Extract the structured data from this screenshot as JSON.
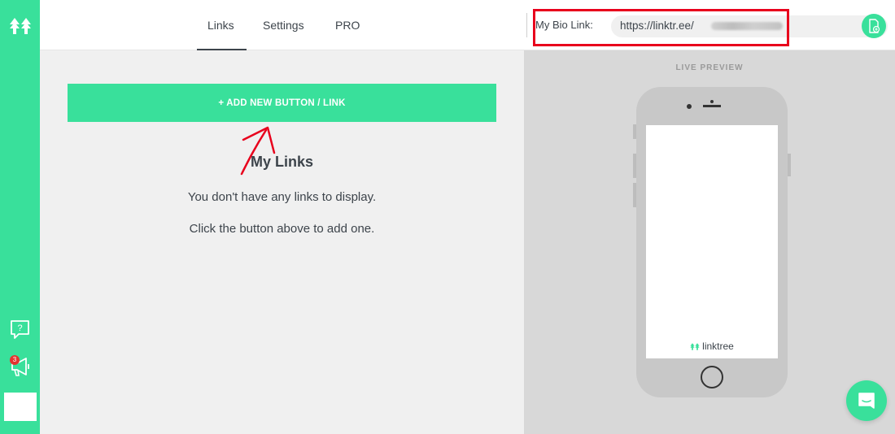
{
  "nav": {
    "tabs": [
      {
        "label": "Links"
      },
      {
        "label": "Settings"
      },
      {
        "label": "PRO"
      }
    ]
  },
  "sidebar": {
    "notification_count": "3",
    "icons": [
      "linktree-logo-icon",
      "help-icon",
      "megaphone-icon",
      "avatar"
    ]
  },
  "main": {
    "add_button_label": "+ ADD NEW BUTTON / LINK",
    "my_links_title": "My Links",
    "empty_message_1": "You don't have any links to display.",
    "empty_message_2": "Click the button above to add one."
  },
  "bio": {
    "label": "My Bio Link:",
    "url_prefix": "https://linktr.ee/"
  },
  "preview": {
    "heading": "LIVE PREVIEW",
    "brand": "linktree"
  },
  "colors": {
    "brand_green": "#39e09b",
    "highlight_red": "#e8001c",
    "badge_red": "#e3342f",
    "text_dark": "#3d444b"
  }
}
